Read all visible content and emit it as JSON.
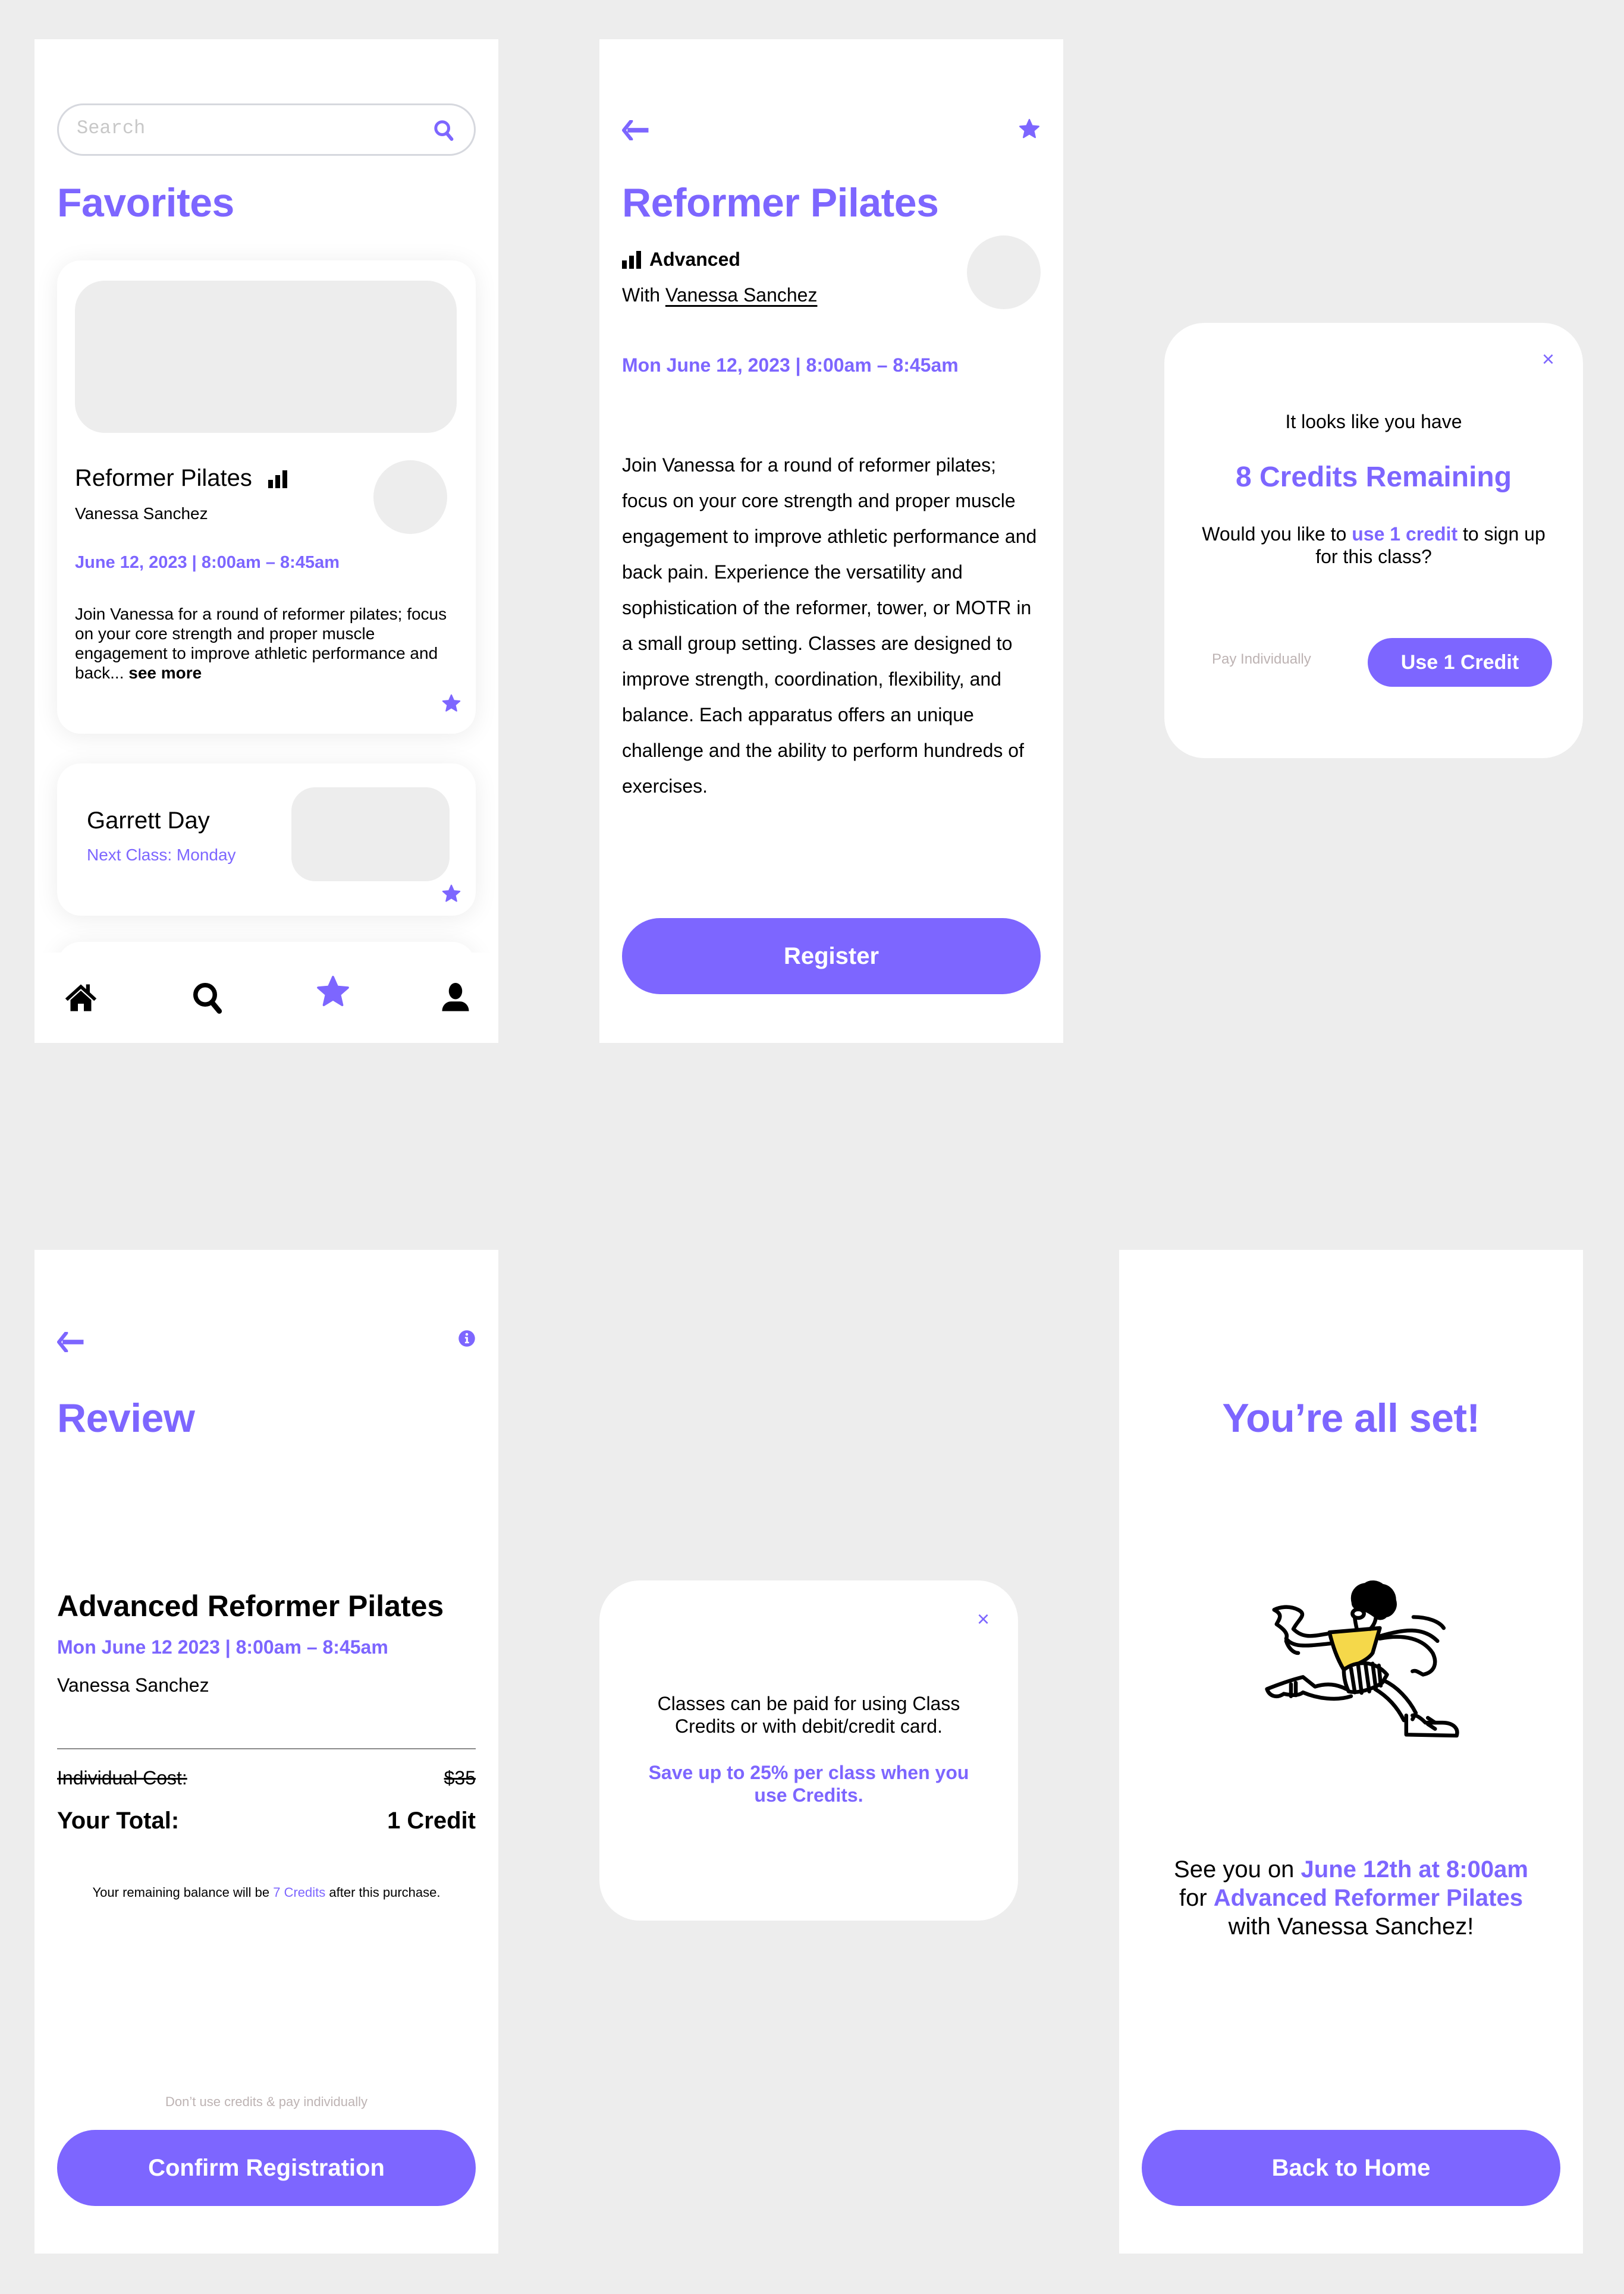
{
  "colors": {
    "accent": "#7d66ff",
    "placeholder_bg": "#ededed",
    "muted": "#bdb3b3",
    "canvas": "#ededed",
    "illustration_yellow": "#f5d84a"
  },
  "favorites_screen": {
    "search_placeholder": "Search",
    "title": "Favorites",
    "class_card": {
      "title": "Reformer Pilates",
      "level_icon": "level-bars-icon",
      "instructor": "Vanessa Sanchez",
      "date": "June 12, 2023 | 8:00am – 8:45am",
      "description": "Join Vanessa for a round of reformer pilates; focus on your core strength and proper muscle engagement to improve athletic performance and back... ",
      "see_more": "see more",
      "favorited": true
    },
    "instructor_card": {
      "name": "Garrett Day",
      "next_class": "Next Class: Monday",
      "favorited": true
    },
    "nav": [
      {
        "label": "Home",
        "icon": "home-icon",
        "active": false
      },
      {
        "label": "Search",
        "icon": "search-icon",
        "active": false
      },
      {
        "label": "Favorites",
        "icon": "star-icon",
        "active": true
      },
      {
        "label": "Profile",
        "icon": "user-icon",
        "active": false
      }
    ]
  },
  "class_detail_screen": {
    "title": "Reformer Pilates",
    "level": "Advanced",
    "with_prefix": "With ",
    "instructor": "Vanessa Sanchez",
    "date": "Mon June 12, 2023 | 8:00am – 8:45am",
    "description": "Join Vanessa for a round of reformer pilates; focus on your core strength and proper muscle engagement to improve athletic performance and back pain. Experience the versatility and sophistication of the reformer, tower, or MOTR in a small group setting. Classes are designed to improve strength, coordination, flexibility, and balance. Each apparatus offers an unique challenge and the ability to perform hundreds of exercises.",
    "register_label": "Register"
  },
  "credits_modal": {
    "close": "×",
    "intro": "It looks like you have",
    "credits_remaining": "8 Credits Remaining",
    "question_pre": "Would you like to ",
    "question_highlight": "use 1 credit",
    "question_post": " to sign up for this class?",
    "pay_individually": "Pay Individually",
    "use_credit_label": "Use 1 Credit"
  },
  "review_screen": {
    "title": "Review",
    "class_name": "Advanced Reformer Pilates",
    "date": "Mon June 12 2023 | 8:00am – 8:45am",
    "instructor": "Vanessa Sanchez",
    "individual_cost_label": "Individual Cost:",
    "individual_cost_value": "$35",
    "total_label": "Your Total:",
    "total_value": "1 Credit",
    "balance_pre": "Your remaining balance will be ",
    "balance_highlight": "7 Credits",
    "balance_post": " after this purchase.",
    "skip_credits": "Don’t use credits & pay individually",
    "confirm_label": "Confirm Registration"
  },
  "info_modal": {
    "close": "×",
    "text": "Classes can be paid for using Class Credits or with debit/credit card.",
    "highlight": "Save up to 25% per class when you use Credits."
  },
  "confirmation_screen": {
    "title": "You’re all set!",
    "msg_1": "See you on ",
    "msg_date": "June 12th at 8:00am",
    "msg_2": " for ",
    "msg_class": "Advanced Reformer Pilates",
    "msg_3": " with Vanessa Sanchez!",
    "illustration": "running-person-illustration",
    "home_label": "Back to Home"
  }
}
